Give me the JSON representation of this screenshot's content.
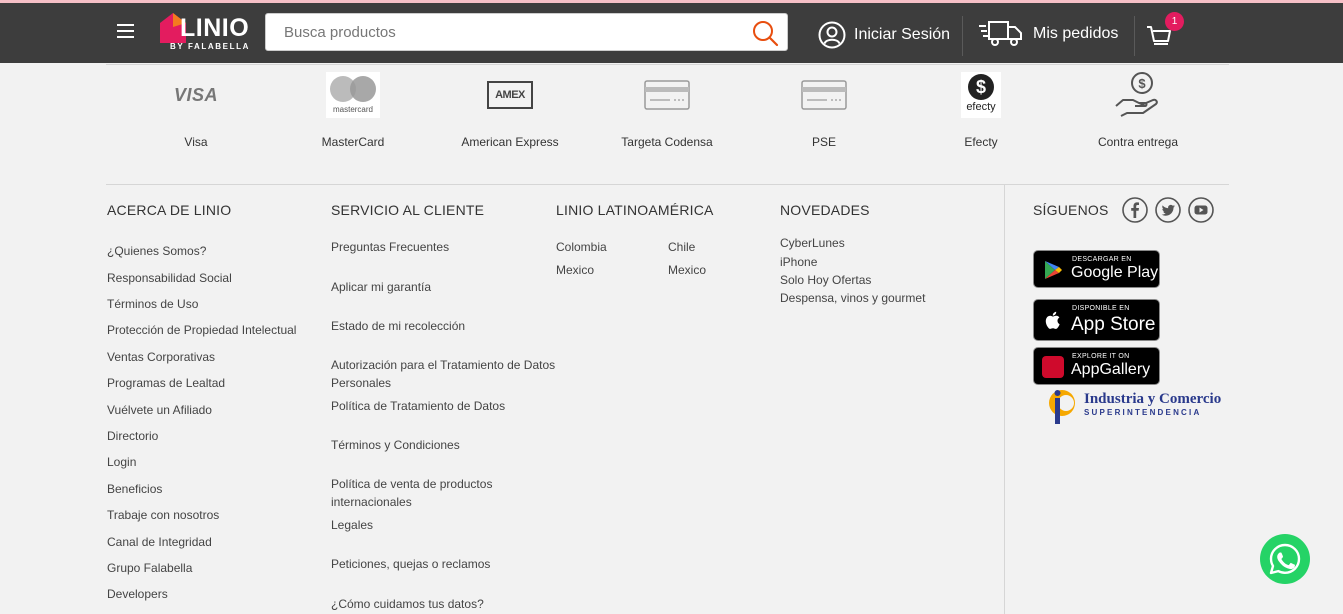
{
  "header": {
    "logo_text": "LINIO",
    "logo_sub": "BY FALABELLA",
    "search_placeholder": "Busca productos",
    "login_label": "Iniciar Sesión",
    "orders_label": "Mis pedidos",
    "cart_count": "1"
  },
  "payments": [
    {
      "label": "Visa",
      "icon": "visa-icon"
    },
    {
      "label": "MasterCard",
      "icon": "mastercard-icon"
    },
    {
      "label": "American Express",
      "icon": "amex-icon"
    },
    {
      "label": "Targeta Codensa",
      "icon": "card-icon"
    },
    {
      "label": "PSE",
      "icon": "card-icon"
    },
    {
      "label": "Efecty",
      "icon": "efecty-icon"
    },
    {
      "label": "Contra entrega",
      "icon": "cash-hand-icon"
    }
  ],
  "payment_logo_text": {
    "visa": "VISA",
    "mastercard": "mastercard",
    "amex": "AMEX",
    "efecty": "efecty"
  },
  "footer": {
    "about": {
      "title": "ACERCA DE LINIO",
      "links": [
        "¿Quienes Somos?",
        "Responsabilidad Social",
        "Términos de Uso",
        "Protección de Propiedad Intelectual",
        "Ventas Corporativas",
        "Programas de Lealtad",
        "Vuélvete un Afiliado",
        "Directorio",
        "Login",
        "Beneficios",
        "Trabaje con nosotros",
        "Canal de Integridad",
        "Grupo Falabella",
        "Developers"
      ]
    },
    "service": {
      "title": "SERVICIO AL CLIENTE",
      "links": [
        "Preguntas Frecuentes",
        "Aplicar mi garantía",
        "Estado de mi recolección",
        "Autorización para el Tratamiento de Datos Personales",
        "Política de Tratamiento de Datos",
        "Términos y Condiciones",
        "Política de venta de productos internacionales",
        "Legales",
        "Peticiones, quejas o reclamos",
        "¿Cómo cuidamos tus datos?"
      ]
    },
    "latam": {
      "title": "LINIO LATINOAMÉRICA",
      "links": [
        "Colombia",
        "Chile",
        "Mexico",
        "Mexico"
      ]
    },
    "news": {
      "title": "NOVEDADES",
      "links": [
        "CyberLunes",
        "iPhone",
        "Solo Hoy Ofertas",
        "Despensa, vinos y gourmet"
      ]
    },
    "follow": {
      "title": "SÍGUENOS",
      "social": [
        "facebook-icon",
        "twitter-icon",
        "youtube-icon"
      ]
    },
    "stores": [
      {
        "top": "DESCARGAR EN",
        "main": "Google Play",
        "icon": "google-play-icon"
      },
      {
        "top": "DISPONIBLE EN",
        "main": "App Store",
        "icon": "apple-icon"
      },
      {
        "top": "EXPLORE IT ON",
        "main": "AppGallery",
        "icon": "huawei-icon"
      }
    ],
    "sic": {
      "line1": "Industria y Comercio",
      "line2": "SUPERINTENDENCIA"
    }
  },
  "colors": {
    "header_bg": "#3d3d3d",
    "accent": "#e84e0f",
    "badge": "#e31c5f",
    "whatsapp": "#25d366"
  }
}
